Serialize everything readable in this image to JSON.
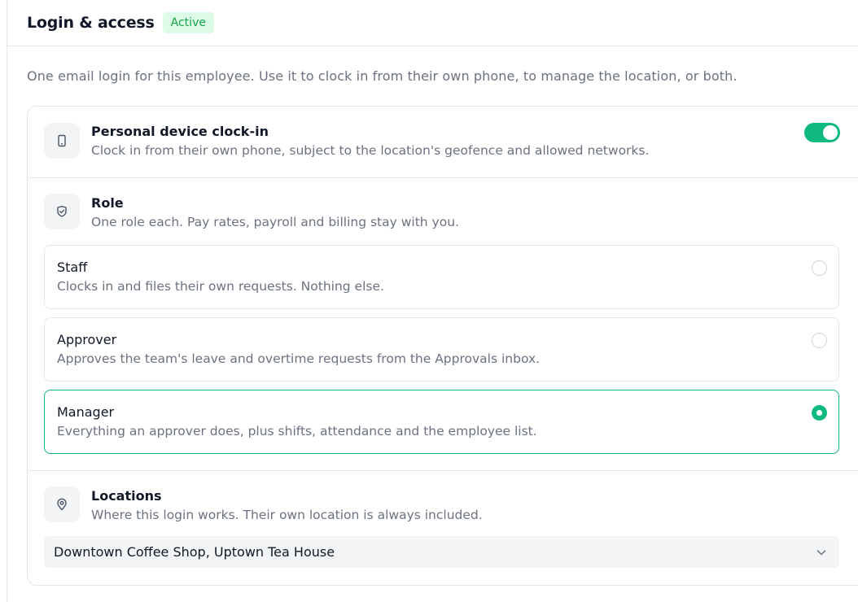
{
  "header": {
    "title": "Login & access",
    "status_badge": "Active"
  },
  "intro": "One email login for this employee. Use it to clock in from their own phone, to manage the location, or both.",
  "device": {
    "icon": "phone-icon",
    "title": "Personal device clock-in",
    "description": "Clock in from their own phone, subject to the location's geofence and allowed networks.",
    "enabled": true
  },
  "role": {
    "icon": "shield-check-icon",
    "title": "Role",
    "description": "One role each. Pay rates, payroll and billing stay with you.",
    "options": [
      {
        "title": "Staff",
        "description": "Clocks in and files their own requests. Nothing else.",
        "selected": false
      },
      {
        "title": "Approver",
        "description": "Approves the team's leave and overtime requests from the Approvals inbox.",
        "selected": false
      },
      {
        "title": "Manager",
        "description": "Everything an approver does, plus shifts, attendance and the employee list.",
        "selected": true
      }
    ]
  },
  "locations": {
    "icon": "map-pin-icon",
    "title": "Locations",
    "description": "Where this login works. Their own location is always included.",
    "selected_value": "Downtown Coffee Shop, Uptown Tea House"
  },
  "colors": {
    "accent": "#10b981",
    "badge_bg": "#dcfce7",
    "badge_text": "#16a34a",
    "muted_text": "#6b7280"
  }
}
